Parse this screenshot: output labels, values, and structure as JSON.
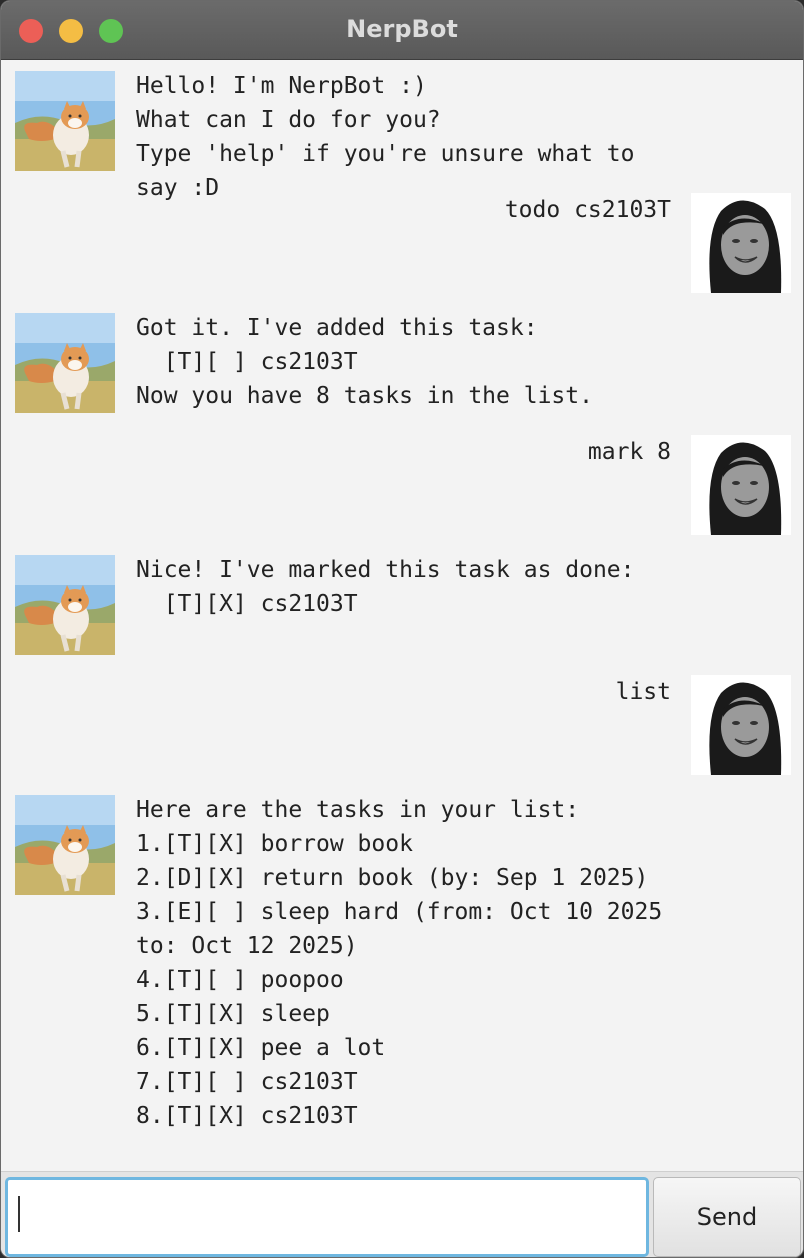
{
  "window": {
    "title": "NerpBot"
  },
  "colors": {
    "close": "#ec5f57",
    "minimize": "#f4bd44",
    "maximize": "#5fc454",
    "input_focus": "#6fb7e0"
  },
  "conversation": [
    {
      "sender": "bot",
      "text": "Hello! I'm NerpBot :)\nWhat can I do for you?\nType 'help' if you're unsure what to say :D"
    },
    {
      "sender": "user",
      "text": "todo cs2103T"
    },
    {
      "sender": "bot",
      "text": "Got it. I've added this task:\n  [T][ ] cs2103T\nNow you have 8 tasks in the list."
    },
    {
      "sender": "user",
      "text": "mark 8"
    },
    {
      "sender": "bot",
      "text": "Nice! I've marked this task as done:\n  [T][X] cs2103T"
    },
    {
      "sender": "user",
      "text": "list"
    },
    {
      "sender": "bot",
      "text": "Here are the tasks in your list:\n1.[T][X] borrow book\n2.[D][X] return book (by: Sep 1 2025)\n3.[E][ ] sleep hard (from: Oct 10 2025 to: Oct 12 2025)\n4.[T][ ] poopoo\n5.[T][X] sleep\n6.[T][X] pee a lot\n7.[T][ ] cs2103T\n8.[T][X] cs2103T"
    }
  ],
  "input": {
    "value": "",
    "placeholder": ""
  },
  "send_button": {
    "label": "Send"
  },
  "icons": {
    "bot_avatar": "cat-avatar-icon",
    "user_avatar": "user-portrait-icon"
  }
}
